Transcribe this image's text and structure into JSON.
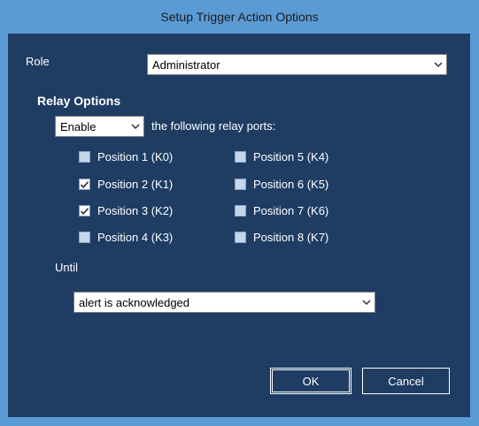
{
  "window": {
    "title": "Setup Trigger Action Options"
  },
  "role": {
    "label": "Role",
    "value": "Administrator"
  },
  "relay": {
    "heading": "Relay Options",
    "mode_value": "Enable",
    "mode_suffix": "the following relay ports:",
    "positions": [
      {
        "label": "Position 1 (K0)",
        "checked": false
      },
      {
        "label": "Position 2 (K1)",
        "checked": true
      },
      {
        "label": "Position 3 (K2)",
        "checked": true
      },
      {
        "label": "Position 4 (K3)",
        "checked": false
      },
      {
        "label": "Position 5 (K4)",
        "checked": false
      },
      {
        "label": "Position 6 (K5)",
        "checked": false
      },
      {
        "label": "Position 7 (K6)",
        "checked": false
      },
      {
        "label": "Position 8 (K7)",
        "checked": false
      }
    ]
  },
  "until": {
    "label": "Until",
    "value": "alert is acknowledged"
  },
  "buttons": {
    "ok": "OK",
    "cancel": "Cancel"
  },
  "colors": {
    "frame": "#5b9bd5",
    "client": "#1f3d63",
    "checkbox": "#c5d6ea"
  }
}
